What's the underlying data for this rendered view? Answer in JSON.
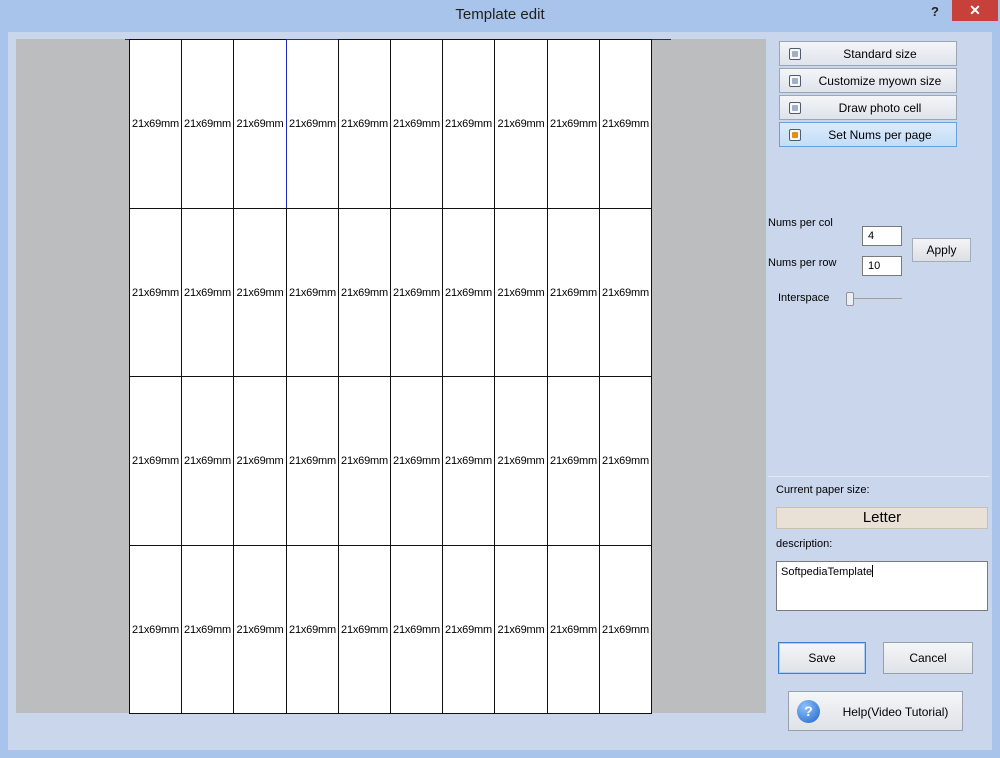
{
  "window": {
    "title": "Template edit",
    "help_glyph": "?",
    "close_glyph": "✕"
  },
  "preview": {
    "cell_label": "21x69mm",
    "rows": 4,
    "cols": 10
  },
  "options": [
    {
      "label": "Standard size",
      "active": false
    },
    {
      "label": "Customize myown size",
      "active": false
    },
    {
      "label": "Draw photo cell",
      "active": false
    },
    {
      "label": "Set Nums per page",
      "active": true
    }
  ],
  "nums": {
    "per_col_label": "Nums per col",
    "per_col_value": "4",
    "per_row_label": "Nums per row",
    "per_row_value": "10",
    "apply_label": "Apply",
    "interspace_label": "Interspace",
    "interspace_value": 0
  },
  "paper": {
    "label": "Current paper size:",
    "value": "Letter"
  },
  "description": {
    "label": "description:",
    "value": "SoftpediaTemplate"
  },
  "actions": {
    "save": "Save",
    "cancel": "Cancel",
    "help_video": "Help(Video Tutorial)",
    "help_icon_glyph": "?"
  }
}
